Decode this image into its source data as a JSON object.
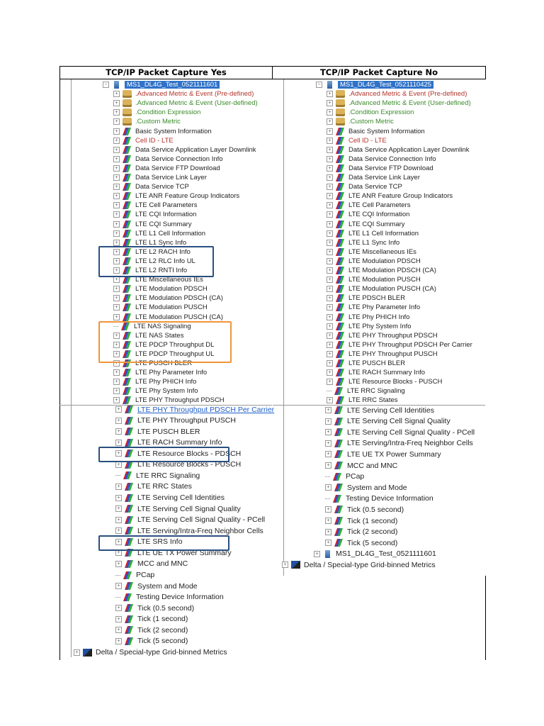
{
  "headers": {
    "left": "TCP/IP Packet Capture Yes",
    "right": "TCP/IP Packet Capture No"
  },
  "colors": {
    "highlight_blue": "#2a4f80",
    "highlight_orange": "#f0953a",
    "red_text": "#b3332b",
    "green_text": "#3a8a2a",
    "selection": "#3072c8"
  },
  "left_top": [
    {
      "label": "MS1_DL4G_Test_0521111601",
      "icon": "device",
      "exp": "minus",
      "style": "sel",
      "root": true
    },
    {
      "label": ".Advanced Metric & Event (Pre-defined)",
      "icon": "folder",
      "exp": "plus",
      "style": "red"
    },
    {
      "label": ".Advanced Metric & Event (User-defined)",
      "icon": "folder",
      "exp": "plus",
      "style": "green"
    },
    {
      "label": ".Condition Expression",
      "icon": "folder",
      "exp": "plus",
      "style": "green"
    },
    {
      "label": ".Custom Metric",
      "icon": "folder",
      "exp": "plus",
      "style": "green"
    },
    {
      "label": "Basic System Information",
      "icon": "metric",
      "exp": "plus"
    },
    {
      "label": "Cell ID - LTE",
      "icon": "metric",
      "exp": "plus",
      "style": "red"
    },
    {
      "label": "Data Service Application Layer Downlink",
      "icon": "metric",
      "exp": "plus"
    },
    {
      "label": "Data Service Connection Info",
      "icon": "metric",
      "exp": "plus"
    },
    {
      "label": "Data Service FTP Download",
      "icon": "metric",
      "exp": "plus"
    },
    {
      "label": "Data Service Link Layer",
      "icon": "metric",
      "exp": "plus"
    },
    {
      "label": "Data Service TCP",
      "icon": "metric",
      "exp": "plus"
    },
    {
      "label": "LTE ANR Feature Group Indicators",
      "icon": "metric",
      "exp": "plus"
    },
    {
      "label": "LTE Cell Parameters",
      "icon": "metric",
      "exp": "plus"
    },
    {
      "label": "LTE CQI Information",
      "icon": "metric",
      "exp": "plus"
    },
    {
      "label": "LTE CQI Summary",
      "icon": "metric",
      "exp": "plus"
    },
    {
      "label": "LTE L1 Cell Information",
      "icon": "metric",
      "exp": "plus"
    },
    {
      "label": "LTE L1 Sync Info",
      "icon": "metric",
      "exp": "plus"
    },
    {
      "label": "LTE L2 RACH Info",
      "icon": "metric",
      "exp": "plus"
    },
    {
      "label": "LTE L2 RLC Info UL",
      "icon": "metric",
      "exp": "plus"
    },
    {
      "label": "LTE L2 RNTI Info",
      "icon": "metric",
      "exp": "plus"
    },
    {
      "label": "LTE Miscellaneous IEs",
      "icon": "metric",
      "exp": "plus"
    },
    {
      "label": "LTE Modulation PDSCH",
      "icon": "metric",
      "exp": "plus"
    },
    {
      "label": "LTE Modulation PDSCH (CA)",
      "icon": "metric",
      "exp": "plus"
    },
    {
      "label": "LTE Modulation PUSCH",
      "icon": "metric",
      "exp": "plus"
    },
    {
      "label": "LTE Modulation PUSCH (CA)",
      "icon": "metric",
      "exp": "plus"
    },
    {
      "label": "LTE NAS Signaling",
      "icon": "metric",
      "exp": "line"
    },
    {
      "label": "LTE NAS States",
      "icon": "metric",
      "exp": "plus"
    },
    {
      "label": "LTE PDCP Throughput DL",
      "icon": "metric",
      "exp": "plus"
    },
    {
      "label": "LTE PDCP Throughput UL",
      "icon": "metric",
      "exp": "plus"
    },
    {
      "label": "LTE PUSCH BLER",
      "icon": "metric",
      "exp": "plus"
    },
    {
      "label": "LTE Phy Parameter Info",
      "icon": "metric",
      "exp": "plus"
    },
    {
      "label": "LTE Phy PHICH Info",
      "icon": "metric",
      "exp": "plus"
    },
    {
      "label": "LTE Phy System Info",
      "icon": "metric",
      "exp": "plus"
    },
    {
      "label": "LTE PHY Throughput PDSCH",
      "icon": "metric",
      "exp": "plus"
    }
  ],
  "left_bottom": [
    {
      "label": "LTE PHY Throughput PDSCH Per Carrier",
      "icon": "metric",
      "exp": "plus",
      "style": "link"
    },
    {
      "label": "LTE PHY Throughput PUSCH",
      "icon": "metric",
      "exp": "plus"
    },
    {
      "label": "LTE PUSCH BLER",
      "icon": "metric",
      "exp": "plus"
    },
    {
      "label": "LTE RACH Summary Info",
      "icon": "metric",
      "exp": "plus"
    },
    {
      "label": "LTE Resource Blocks - PDSCH",
      "icon": "metric",
      "exp": "plus"
    },
    {
      "label": "LTE Resource Blocks - PUSCH",
      "icon": "metric",
      "exp": "plus"
    },
    {
      "label": "LTE RRC Signaling",
      "icon": "metric",
      "exp": "line"
    },
    {
      "label": "LTE RRC States",
      "icon": "metric",
      "exp": "plus"
    },
    {
      "label": "LTE Serving Cell Identities",
      "icon": "metric",
      "exp": "plus"
    },
    {
      "label": "LTE Serving Cell Signal Quality",
      "icon": "metric",
      "exp": "plus"
    },
    {
      "label": "LTE Serving Cell Signal Quality - PCell",
      "icon": "metric",
      "exp": "plus"
    },
    {
      "label": "LTE Serving/Intra-Freq Neighbor Cells",
      "icon": "metric",
      "exp": "plus"
    },
    {
      "label": "LTE SRS Info",
      "icon": "metric",
      "exp": "plus"
    },
    {
      "label": "LTE UE TX Power Summary",
      "icon": "metric",
      "exp": "plus"
    },
    {
      "label": "MCC and MNC",
      "icon": "metric",
      "exp": "plus"
    },
    {
      "label": "PCap",
      "icon": "metric",
      "exp": "line"
    },
    {
      "label": "System and Mode",
      "icon": "metric",
      "exp": "plus"
    },
    {
      "label": "Testing Device Information",
      "icon": "metric",
      "exp": "line"
    },
    {
      "label": "Tick (0.5 second)",
      "icon": "metric",
      "exp": "plus"
    },
    {
      "label": "Tick (1 second)",
      "icon": "metric",
      "exp": "plus"
    },
    {
      "label": "Tick (2 second)",
      "icon": "metric",
      "exp": "plus"
    },
    {
      "label": "Tick (5 second)",
      "icon": "metric",
      "exp": "plus"
    },
    {
      "label": "Delta / Special-type Grid-binned Metrics",
      "icon": "grid",
      "exp": "plus",
      "level": 0
    }
  ],
  "right_top": [
    {
      "label": "MS1_DL4G_Test_0521110425",
      "icon": "device",
      "exp": "minus",
      "style": "sel",
      "root": true
    },
    {
      "label": ".Advanced Metric & Event (Pre-defined)",
      "icon": "folder",
      "exp": "plus",
      "style": "red"
    },
    {
      "label": ".Advanced Metric & Event (User-defined)",
      "icon": "folder",
      "exp": "plus",
      "style": "green"
    },
    {
      "label": ".Condition Expression",
      "icon": "folder",
      "exp": "plus",
      "style": "green"
    },
    {
      "label": ".Custom Metric",
      "icon": "folder",
      "exp": "plus",
      "style": "green"
    },
    {
      "label": "Basic System Information",
      "icon": "metric",
      "exp": "plus"
    },
    {
      "label": "Cell ID - LTE",
      "icon": "metric",
      "exp": "plus",
      "style": "red"
    },
    {
      "label": "Data Service Application Layer Downlink",
      "icon": "metric",
      "exp": "plus"
    },
    {
      "label": "Data Service Connection Info",
      "icon": "metric",
      "exp": "plus"
    },
    {
      "label": "Data Service FTP Download",
      "icon": "metric",
      "exp": "plus"
    },
    {
      "label": "Data Service Link Layer",
      "icon": "metric",
      "exp": "plus"
    },
    {
      "label": "Data Service TCP",
      "icon": "metric",
      "exp": "plus"
    },
    {
      "label": "LTE ANR Feature Group Indicators",
      "icon": "metric",
      "exp": "plus"
    },
    {
      "label": "LTE Cell Parameters",
      "icon": "metric",
      "exp": "plus"
    },
    {
      "label": "LTE CQI Information",
      "icon": "metric",
      "exp": "plus"
    },
    {
      "label": "LTE CQI Summary",
      "icon": "metric",
      "exp": "plus"
    },
    {
      "label": "LTE L1 Cell Information",
      "icon": "metric",
      "exp": "plus"
    },
    {
      "label": "LTE L1 Sync Info",
      "icon": "metric",
      "exp": "plus"
    },
    {
      "label": "LTE Miscellaneous IEs",
      "icon": "metric",
      "exp": "plus"
    },
    {
      "label": "LTE Modulation PDSCH",
      "icon": "metric",
      "exp": "plus"
    },
    {
      "label": "LTE Modulation PDSCH (CA)",
      "icon": "metric",
      "exp": "plus"
    },
    {
      "label": "LTE Modulation PUSCH",
      "icon": "metric",
      "exp": "plus"
    },
    {
      "label": "LTE Modulation PUSCH (CA)",
      "icon": "metric",
      "exp": "plus"
    },
    {
      "label": "LTE PDSCH BLER",
      "icon": "metric",
      "exp": "plus"
    },
    {
      "label": "LTE Phy Parameter Info",
      "icon": "metric",
      "exp": "plus"
    },
    {
      "label": "LTE Phy PHICH Info",
      "icon": "metric",
      "exp": "plus"
    },
    {
      "label": "LTE Phy System Info",
      "icon": "metric",
      "exp": "plus"
    },
    {
      "label": "LTE PHY Throughput PDSCH",
      "icon": "metric",
      "exp": "plus"
    },
    {
      "label": "LTE PHY Throughput PDSCH Per Carrier",
      "icon": "metric",
      "exp": "plus"
    },
    {
      "label": "LTE PHY Throughput PUSCH",
      "icon": "metric",
      "exp": "plus"
    },
    {
      "label": "LTE PUSCH BLER",
      "icon": "metric",
      "exp": "plus"
    },
    {
      "label": "LTE RACH Summary Info",
      "icon": "metric",
      "exp": "plus"
    },
    {
      "label": "LTE Resource Blocks - PUSCH",
      "icon": "metric",
      "exp": "plus"
    },
    {
      "label": "LTE RRC Signaling",
      "icon": "metric",
      "exp": "line"
    },
    {
      "label": "LTE RRC States",
      "icon": "metric",
      "exp": "plus"
    }
  ],
  "right_bottom": [
    {
      "label": "LTE Serving Cell Identities",
      "icon": "metric",
      "exp": "plus"
    },
    {
      "label": "LTE Serving Cell Signal Quality",
      "icon": "metric",
      "exp": "plus"
    },
    {
      "label": "LTE Serving Cell Signal Quality - PCell",
      "icon": "metric",
      "exp": "plus"
    },
    {
      "label": "LTE Serving/Intra-Freq Neighbor Cells",
      "icon": "metric",
      "exp": "plus"
    },
    {
      "label": "LTE UE TX Power Summary",
      "icon": "metric",
      "exp": "plus"
    },
    {
      "label": "MCC and MNC",
      "icon": "metric",
      "exp": "plus"
    },
    {
      "label": "PCap",
      "icon": "metric",
      "exp": "line"
    },
    {
      "label": "System and Mode",
      "icon": "metric",
      "exp": "plus"
    },
    {
      "label": "Testing Device Information",
      "icon": "metric",
      "exp": "line"
    },
    {
      "label": "Tick (0.5 second)",
      "icon": "metric",
      "exp": "plus"
    },
    {
      "label": "Tick (1 second)",
      "icon": "metric",
      "exp": "plus"
    },
    {
      "label": "Tick (2 second)",
      "icon": "metric",
      "exp": "plus"
    },
    {
      "label": "Tick (5 second)",
      "icon": "metric",
      "exp": "plus"
    },
    {
      "label": "MS1_DL4G_Test_0521111601",
      "icon": "device",
      "exp": "plus",
      "level": 1
    },
    {
      "label": "Delta / Special-type Grid-binned Metrics",
      "icon": "grid",
      "exp": "plus",
      "level": 0
    }
  ]
}
